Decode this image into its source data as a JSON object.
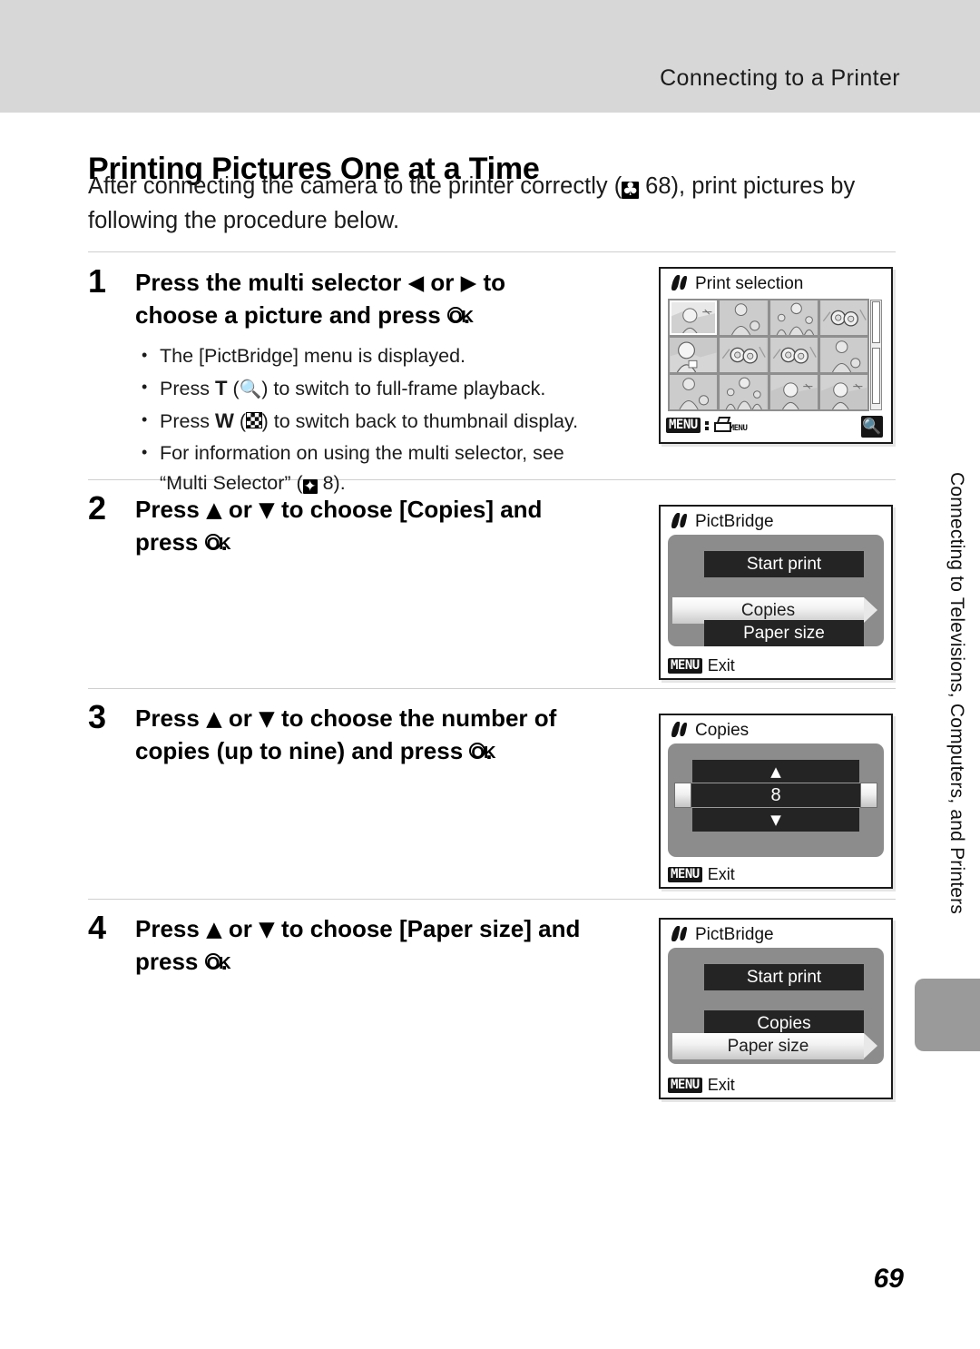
{
  "header": {
    "running_head": "Connecting to a Printer"
  },
  "title": "Printing Pictures One at a Time",
  "intro": {
    "text_before_ref": "After connecting the camera to the printer correctly (",
    "ref_icon": "book-reference-icon",
    "ref_page": "68",
    "text_after_ref": "), print pictures by",
    "line2": "following the procedure below."
  },
  "steps": [
    {
      "number": "1",
      "heading_part1": "Press the multi selector",
      "icon_left": "triangle-left-icon",
      "heading_or": "or",
      "icon_right": "triangle-right-icon",
      "heading_part2": "to",
      "heading_line2_a": "choose a picture and press",
      "ok_icon": "ok-button-icon",
      "heading_line2_b": ".",
      "bullets": [
        {
          "text": "The [PictBridge] menu is displayed."
        },
        {
          "pre": "Press ",
          "key": "T",
          "paren_icon": "magnifier-icon",
          "post": ") to switch to full-frame playback.",
          "paren_open": "("
        },
        {
          "pre": "Press ",
          "key": "W",
          "paren_icon": "thumbnail-grid-icon",
          "post": ") to switch back to thumbnail display.",
          "paren_open": "("
        },
        {
          "text": "For information on using the multi selector, see",
          "line2_pre": "“Multi Selector” (",
          "ref_icon": "multi-selector-icon",
          "line2_post": " 8)."
        }
      ]
    },
    {
      "number": "2",
      "heading_pre": "Press",
      "icon_up": "triangle-up-icon",
      "heading_or": "or",
      "icon_down": "triangle-down-icon",
      "heading_mid": "to choose [Copies] and",
      "heading_line2": "press",
      "ok_icon": "ok-button-icon",
      "heading_end": "."
    },
    {
      "number": "3",
      "heading_pre": "Press",
      "icon_up": "triangle-up-icon",
      "heading_or": "or",
      "icon_down": "triangle-down-icon",
      "heading_mid": "to choose the number of",
      "heading_line2": "copies (up to nine) and press",
      "ok_icon": "ok-button-icon",
      "heading_end": "."
    },
    {
      "number": "4",
      "heading_pre": "Press",
      "icon_up": "triangle-up-icon",
      "heading_or": "or",
      "icon_down": "triangle-down-icon",
      "heading_mid": "to choose [Paper size] and",
      "heading_line2": "press",
      "ok_icon": "ok-button-icon",
      "heading_end": "."
    }
  ],
  "screens": {
    "print_selection": {
      "title": "Print selection",
      "menu_label": "MENU",
      "printer_menu_label": "MENU",
      "magnifier_icon": "magnifier-icon",
      "thumbnails": [
        "woman-with-hat-landscape",
        "woman-with-child",
        "woman-and-two-children",
        "flowers",
        "woman-portrait-closeup",
        "flowers",
        "flowers",
        "woman-with-child",
        "woman-with-child",
        "woman-and-two-children",
        "woman-with-hat-landscape",
        "woman-with-hat-landscape"
      ],
      "selected_index": 0
    },
    "pictbridge_copies": {
      "title": "PictBridge",
      "items": [
        {
          "label": "Start print",
          "highlighted": false
        },
        {
          "label": "Copies",
          "highlighted": true
        },
        {
          "label": "Paper size",
          "highlighted": false
        }
      ],
      "menu_label": "MENU",
      "exit_label": "Exit"
    },
    "copies_counter": {
      "title": "Copies",
      "up_icon": "triangle-up-icon",
      "value": "8",
      "down_icon": "triangle-down-icon",
      "menu_label": "MENU",
      "exit_label": "Exit"
    },
    "pictbridge_paper": {
      "title": "PictBridge",
      "items": [
        {
          "label": "Start print",
          "highlighted": false
        },
        {
          "label": "Copies",
          "highlighted": false
        },
        {
          "label": "Paper size",
          "highlighted": true
        }
      ],
      "menu_label": "MENU",
      "exit_label": "Exit"
    }
  },
  "side_tab": {
    "text": "Connecting to Televisions, Computers, and Printers"
  },
  "page_number": "69"
}
